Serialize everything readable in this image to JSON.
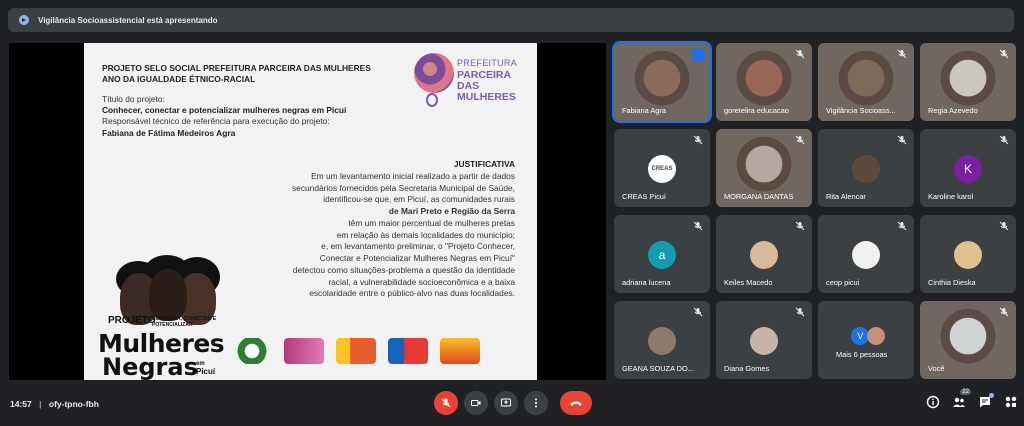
{
  "banner": {
    "text": "Vigilância Socioassistencial está apresentando"
  },
  "slide": {
    "header1": "PROJETO SELO SOCIAL PREFEITURA PARCEIRA DAS MULHERES",
    "header2": "ANO DA IGUALDADE ÉTNICO-RACIAL",
    "title_label": "Título do projeto:",
    "title_value": "Conhecer, conectar e potencializar mulheres negras em Picuí",
    "resp_label": "Responsável técnico de referência para execução do projeto:",
    "resp_value": "Fabiana de Fátima Medeiros Agra",
    "just_title": "JUSTIFICATIVA",
    "just_lines": [
      "Em um levantamento inicial realizado a partir de dados",
      "secundários fornecidos pela Secretaria Municipal de Saúde,",
      "identificou-se que, em Picuí, as comunidades rurais",
      "de Mari Preto e Região da Serra",
      "têm um maior percentual de mulheres pretas",
      "em relação às demais localidades do município;",
      "e, em levantamento preliminar, o \"Projeto Conhecer,",
      "Conectar e Potencializar Mulheres Negras em Picuí\"",
      "detectou como situações-problema a questão da identidade",
      "racial, a vulnerabilidade socioeconômica e a baixa",
      "escolaridade entre o público-alvo nas duas localidades."
    ],
    "logo_pref_top": "PREFEITURA",
    "logo_pref_mid": "PARCEIRA DAS",
    "logo_pref_bot": "MULHERES",
    "art_projeto": "PROJETO",
    "art_sub": "CONHECER, CONECTAR E POTENCIALIZAR",
    "art_mulheres": "Mulheres",
    "art_negras": "Negras",
    "art_em": "em",
    "art_picui": "Picuí"
  },
  "participants": [
    {
      "name": "Fabiana Agra",
      "type": "photo",
      "color": "#8a6a58",
      "speaking": true
    },
    {
      "name": "goretelira educacao",
      "type": "photo",
      "color": "#9a6656"
    },
    {
      "name": "Vigilância Socioass...",
      "type": "photo",
      "color": "#7f6a5a"
    },
    {
      "name": "Regia Azevedo",
      "type": "photo",
      "color": "#ccc6c0"
    },
    {
      "name": "CREAS Picuí",
      "type": "avatar",
      "letter": "CREAS",
      "color": "#ffffff"
    },
    {
      "name": "MORGANA DANTAS",
      "type": "photo",
      "color": "#b4a9a2"
    },
    {
      "name": "Rita Alencar",
      "type": "avatar",
      "letter": "",
      "color": "#5d4a3d"
    },
    {
      "name": "Karoline karol",
      "type": "avatar",
      "letter": "K",
      "color": "#7b1fa2"
    },
    {
      "name": "adriana lucena",
      "type": "avatar",
      "letter": "a",
      "color": "#129eaf"
    },
    {
      "name": "Keiles Macedo",
      "type": "avatar",
      "letter": "",
      "color": "#d9b99c"
    },
    {
      "name": "ceop picui",
      "type": "avatar",
      "letter": "",
      "color": "#f1f1f1"
    },
    {
      "name": "Cinthia Dieska",
      "type": "avatar",
      "letter": "",
      "color": "#e2c28c"
    },
    {
      "name": "GEANA SOUZA DO...",
      "type": "avatar",
      "letter": "",
      "color": "#8f7a6a"
    },
    {
      "name": "Diana Gomes",
      "type": "avatar",
      "letter": "",
      "color": "#c7b4a6"
    },
    {
      "name": "Mais 6 pessoas",
      "type": "more",
      "letter": "V",
      "color": "#1a73e8"
    },
    {
      "name": "Você",
      "type": "photo",
      "color": "#cfd3d4"
    }
  ],
  "bottom": {
    "time": "14:57",
    "separator": "|",
    "meeting_code": "ofy-tpno-fbh",
    "people_count": "22",
    "chat_dot": ""
  },
  "colors": {
    "bg": "#202124",
    "tile": "#3c4043",
    "danger": "#ea4335",
    "accent": "#1a73e8"
  },
  "icons": [
    "present-icon",
    "mic-off-icon",
    "camera-icon",
    "present-screen-icon",
    "more-icon",
    "end-call-icon",
    "info-icon",
    "people-icon",
    "chat-icon",
    "activities-icon"
  ]
}
